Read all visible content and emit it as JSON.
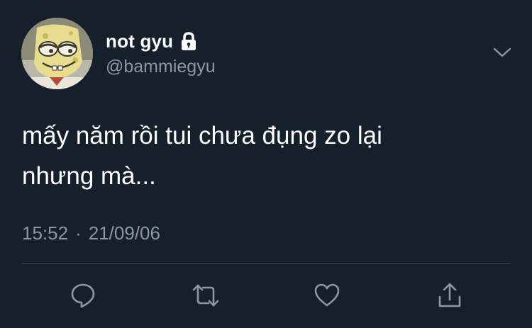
{
  "tweet": {
    "display_name": "not gyu",
    "handle": "@bammiegyu",
    "protected_icon": "lock-icon",
    "text_lines": [
      "mấy năm rồi tui chưa đụng zo lại",
      "nhưng mà..."
    ],
    "time": "15:52",
    "separator": "·",
    "date": "21/09/06"
  },
  "actions": [
    {
      "name": "reply",
      "icon": "reply-icon"
    },
    {
      "name": "retweet",
      "icon": "retweet-icon"
    },
    {
      "name": "like",
      "icon": "heart-icon"
    },
    {
      "name": "share",
      "icon": "share-icon"
    }
  ],
  "colors": {
    "background": "#15202b",
    "text_primary": "#ffffff",
    "text_secondary": "#8899a6",
    "divider": "#38444d"
  }
}
